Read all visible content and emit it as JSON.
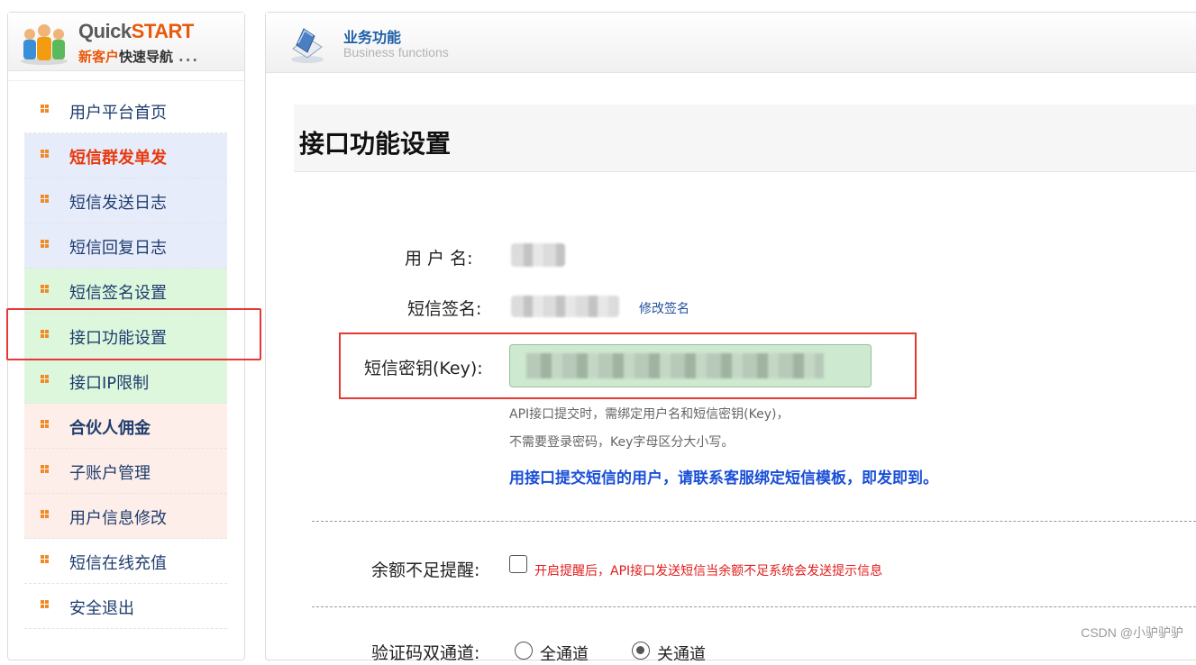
{
  "sidebar": {
    "logo": {
      "title_part1": "Quick",
      "title_part2": "START",
      "sub_orange": "新客户",
      "sub_dark": "快速导航",
      "dots": "..."
    },
    "items": [
      {
        "label": "用户平台首页"
      },
      {
        "label": "短信群发单发"
      },
      {
        "label": "短信发送日志"
      },
      {
        "label": "短信回复日志"
      },
      {
        "label": "短信签名设置"
      },
      {
        "label": "接口功能设置"
      },
      {
        "label": "接口IP限制"
      },
      {
        "label": "合伙人佣金"
      },
      {
        "label": "子账户管理"
      },
      {
        "label": "用户信息修改"
      },
      {
        "label": "短信在线充值"
      },
      {
        "label": "安全退出"
      }
    ]
  },
  "header": {
    "title": "业务功能",
    "subtitle": "Business functions"
  },
  "page": {
    "title": "接口功能设置",
    "username_label": "用 户 名:",
    "signature_label": "短信签名:",
    "edit_signature_link": "修改签名",
    "key_label": "短信密钥(Key):",
    "hint_line1": "API接口提交时，需绑定用户名和短信密钥(Key)，",
    "hint_line2": "不需要登录密码，Key字母区分大小写。",
    "notice": "用接口提交短信的用户，请联系客服绑定短信模板，即发即到。",
    "balance_label": "余额不足提醒:",
    "balance_alert_text": "开启提醒后，API接口发送短信当余额不足系统会发送提示信息",
    "channel_label": "验证码双通道:",
    "channel_option_on": "全通道",
    "channel_option_off": "关通道"
  },
  "watermark": "CSDN @小驴驴驴",
  "colors": {
    "accent_orange": "#e8590c",
    "link_blue": "#1f4f9a",
    "notice_blue": "#1a4fd6",
    "alert_red": "#e11d1d",
    "highlight_red": "#e53935"
  }
}
